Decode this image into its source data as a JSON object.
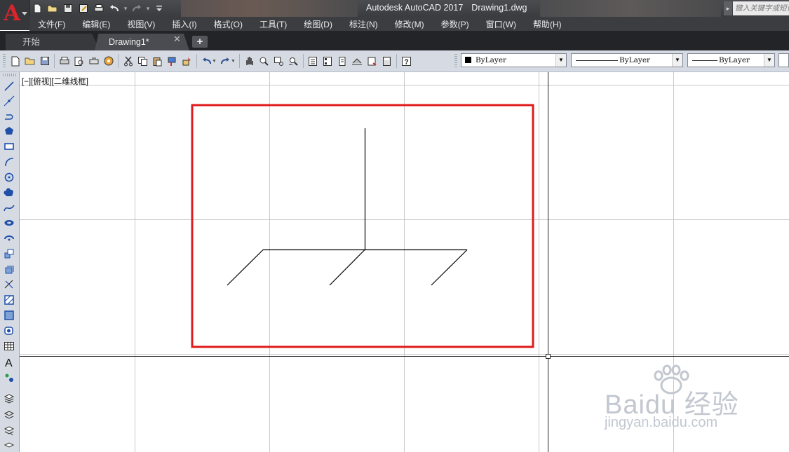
{
  "title_bar": {
    "app_title": "Autodesk AutoCAD 2017",
    "file_name": "Drawing1.dwg",
    "search_placeholder": "键入关键字或短语"
  },
  "menu": [
    {
      "label": "文件(F)"
    },
    {
      "label": "编辑(E)"
    },
    {
      "label": "视图(V)"
    },
    {
      "label": "插入(I)"
    },
    {
      "label": "格式(O)"
    },
    {
      "label": "工具(T)"
    },
    {
      "label": "绘图(D)"
    },
    {
      "label": "标注(N)"
    },
    {
      "label": "修改(M)"
    },
    {
      "label": "参数(P)"
    },
    {
      "label": "窗口(W)"
    },
    {
      "label": "帮助(H)"
    }
  ],
  "tabs": {
    "start_label": "开始",
    "drawing_label": "Drawing1*",
    "new_tab_symbol": "+",
    "close_symbol": "✕"
  },
  "properties": {
    "color": "ByLayer",
    "linetype": "ByLayer",
    "lineweight": "ByLayer"
  },
  "viewport": {
    "label": "[−][俯视][二维线框]"
  },
  "watermark": {
    "brand": "Bai",
    "brand_suffix": "du 经验",
    "url": "jingyan.baidu.com"
  },
  "colors": {
    "highlight_box": "#e01b1b",
    "grid_line": "#c8c8c8",
    "drawing_line": "#000000",
    "logo_red": "#d8242a"
  }
}
